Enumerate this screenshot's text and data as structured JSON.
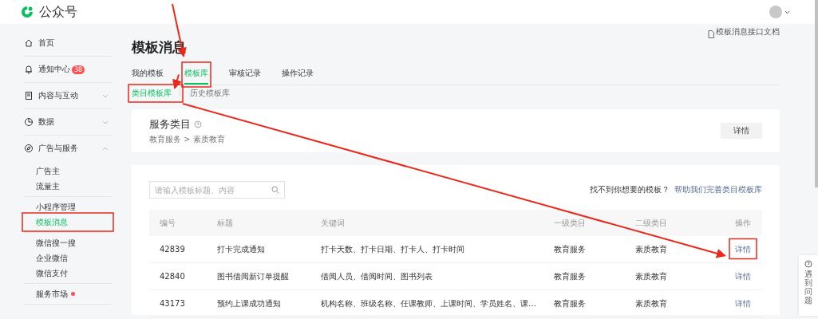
{
  "header": {
    "logo_text": "公众号"
  },
  "sidebar": {
    "items": [
      {
        "kind": "link",
        "label": "首页"
      },
      {
        "kind": "link",
        "label": "通知中心",
        "badge": "38"
      },
      {
        "kind": "group",
        "label": "内容与互动",
        "expanded": false
      },
      {
        "kind": "group",
        "label": "数据",
        "expanded": false
      },
      {
        "kind": "group",
        "label": "广告与服务",
        "expanded": true,
        "sections": [
          {
            "items": [
              {
                "label": "广告主",
                "selected": false
              },
              {
                "label": "流量主",
                "selected": false
              }
            ]
          },
          {
            "items": [
              {
                "label": "小程序管理",
                "selected": false
              },
              {
                "label": "模板消息",
                "selected": true
              }
            ]
          },
          {
            "items": [
              {
                "label": "微信搜一搜",
                "selected": false
              },
              {
                "label": "企业微信",
                "selected": false
              },
              {
                "label": "微信支付",
                "selected": false
              }
            ]
          },
          {
            "items": [
              {
                "label": "服务市场",
                "selected": false,
                "dot": true
              }
            ]
          }
        ]
      }
    ]
  },
  "page": {
    "title": "模板消息",
    "doc_link": "模板消息接口文档"
  },
  "tabs": [
    {
      "label": "我的模板",
      "selected": false
    },
    {
      "label": "模板库",
      "selected": true
    },
    {
      "label": "审核记录",
      "selected": false
    },
    {
      "label": "操作记录",
      "selected": false
    }
  ],
  "subtabs": [
    {
      "label": "类目模板库",
      "selected": true
    },
    {
      "label": "历史模板库",
      "selected": false
    }
  ],
  "category_card": {
    "title": "服务类目",
    "path": "教育服务 > 素质教育",
    "button": "详情"
  },
  "search": {
    "placeholder": "请输入模板标题、内容"
  },
  "hint": {
    "text": "找不到你想要的模板？",
    "link": "帮助我们完善类目模板库"
  },
  "table": {
    "columns": [
      "编号",
      "标题",
      "关键词",
      "一级类目",
      "二级类目",
      "操作"
    ],
    "rows": [
      {
        "id": "42839",
        "title": "打卡完成通知",
        "keywords": "打卡天数、打卡日期、打卡人、打卡时间",
        "level1": "教育服务",
        "level2": "素质教育",
        "action": "详情"
      },
      {
        "id": "42840",
        "title": "图书借阅新订单提醒",
        "keywords": "借阅人员、借阅时间、图书列表",
        "level1": "教育服务",
        "level2": "素质教育",
        "action": "详情"
      },
      {
        "id": "43173",
        "title": "预约上课成功通知",
        "keywords": "机构名称、班级名称、任课教师、上课时间、学员姓名、课…",
        "level1": "教育服务",
        "level2": "素质教育",
        "action": "详情"
      }
    ]
  },
  "help_widget": {
    "text": "遇到问题"
  }
}
